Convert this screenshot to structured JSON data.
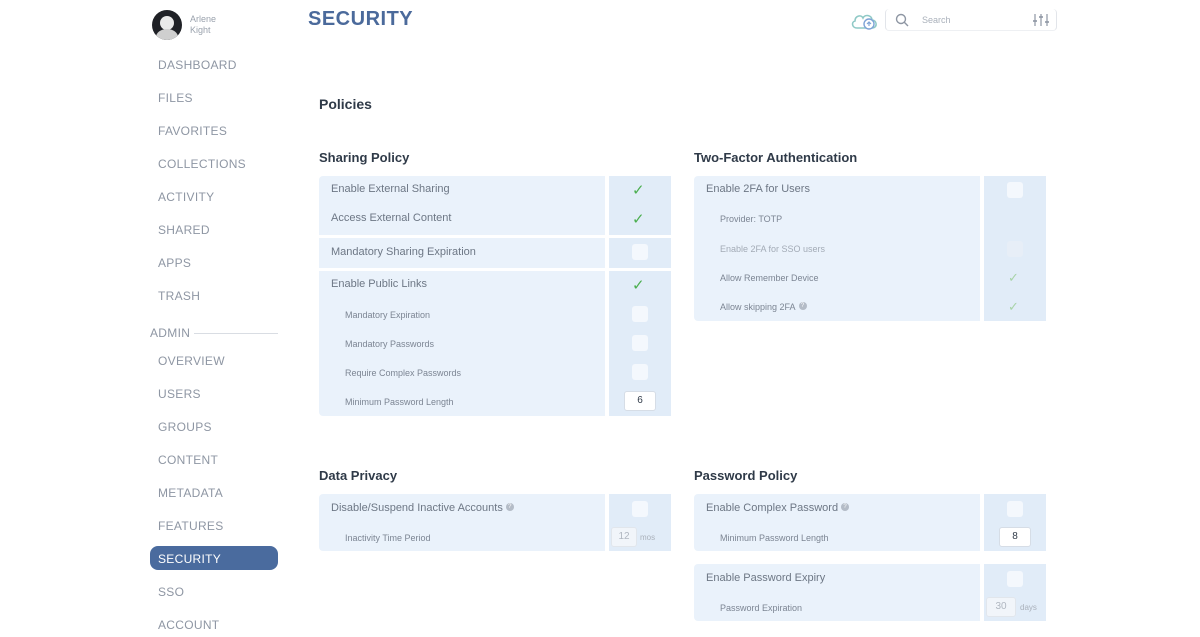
{
  "user": {
    "name": "Arlene Kight"
  },
  "sidebar": {
    "items": [
      {
        "label": "DASHBOARD"
      },
      {
        "label": "FILES"
      },
      {
        "label": "FAVORITES"
      },
      {
        "label": "COLLECTIONS"
      },
      {
        "label": "ACTIVITY"
      },
      {
        "label": "SHARED"
      },
      {
        "label": "APPS"
      },
      {
        "label": "TRASH"
      }
    ],
    "admin_label": "ADMIN",
    "admin_items": [
      {
        "label": "OVERVIEW"
      },
      {
        "label": "USERS"
      },
      {
        "label": "GROUPS"
      },
      {
        "label": "CONTENT"
      },
      {
        "label": "METADATA"
      },
      {
        "label": "FEATURES"
      },
      {
        "label": "SECURITY",
        "active": true
      },
      {
        "label": "SSO"
      },
      {
        "label": "ACCOUNT"
      }
    ]
  },
  "header": {
    "title": "SECURITY",
    "search_placeholder": "Search",
    "icons": [
      "cloud-sync-icon",
      "search-icon",
      "filter-sliders-icon"
    ]
  },
  "main": {
    "heading": "Policies",
    "sharing": {
      "title": "Sharing Policy",
      "enable_external_sharing": {
        "label": "Enable External Sharing",
        "checked": true
      },
      "access_external_content": {
        "label": "Access External Content",
        "checked": true
      },
      "mandatory_sharing_expiration": {
        "label": "Mandatory Sharing Expiration",
        "checked": false
      },
      "enable_public_links": {
        "label": "Enable Public Links",
        "checked": true
      },
      "mandatory_expiration": {
        "label": "Mandatory Expiration",
        "checked": false
      },
      "mandatory_passwords": {
        "label": "Mandatory Passwords",
        "checked": false
      },
      "require_complex_passwords": {
        "label": "Require Complex Passwords",
        "checked": false
      },
      "minimum_password_length": {
        "label": "Minimum Password Length",
        "value": "6"
      }
    },
    "two_factor": {
      "title": "Two-Factor Authentication",
      "enable_2fa": {
        "label": "Enable 2FA for Users",
        "checked": false
      },
      "provider": {
        "label": "Provider: TOTP"
      },
      "enable_2fa_sso": {
        "label": "Enable 2FA for SSO users",
        "checked": false
      },
      "allow_remember_device": {
        "label": "Allow Remember Device",
        "checked": true
      },
      "allow_skipping_2fa": {
        "label": "Allow skipping 2FA",
        "checked": true
      }
    },
    "data_privacy": {
      "title": "Data Privacy",
      "disable_inactive": {
        "label": "Disable/Suspend Inactive Accounts",
        "checked": false
      },
      "inactivity_period": {
        "label": "Inactivity Time Period",
        "value": "12",
        "unit": "mos"
      }
    },
    "password_policy": {
      "title": "Password Policy",
      "enable_complex": {
        "label": "Enable Complex Password",
        "checked": false
      },
      "minimum_length": {
        "label": "Minimum Password Length",
        "value": "8"
      },
      "enable_expiry": {
        "label": "Enable Password Expiry",
        "checked": false
      },
      "expiration": {
        "label": "Password Expiration",
        "value": "30",
        "unit": "days"
      }
    }
  },
  "colors": {
    "accent": "#4a6b9e",
    "panel": "#eaf2fb",
    "check": "#4caf50"
  }
}
